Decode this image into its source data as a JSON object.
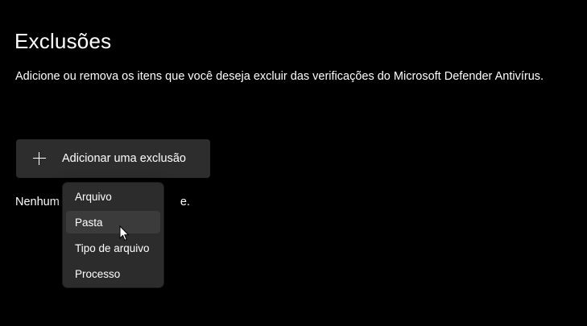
{
  "header": {
    "title": "Exclusões",
    "subtitle": "Adicione ou remova os itens que você deseja excluir das verificações do Microsoft Defender Antivírus."
  },
  "add_button": {
    "icon": "plus-icon",
    "label": "Adicionar uma exclusão"
  },
  "empty_state": {
    "text_visible_left": "Nenhum",
    "text_visible_right": "e."
  },
  "dropdown_menu": {
    "items": [
      {
        "label": "Arquivo"
      },
      {
        "label": "Pasta",
        "hovered": true
      },
      {
        "label": "Tipo de arquivo"
      },
      {
        "label": "Processo"
      }
    ]
  },
  "colors": {
    "background": "#000000",
    "button_bg": "#2d2d2d",
    "menu_bg": "#2c2c2c",
    "menu_hover": "#3b3b3b",
    "text": "#ffffff"
  }
}
